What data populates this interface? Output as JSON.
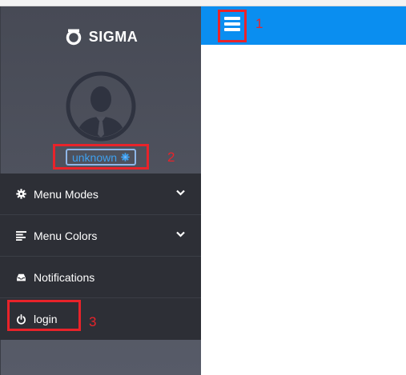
{
  "brand": {
    "name": "SIGMA",
    "logo_icon": "sigma-logo-icon"
  },
  "user": {
    "name": "unknown",
    "settings_icon": "gear-icon"
  },
  "menu": {
    "items": [
      {
        "label": "Menu Modes",
        "icon": "gear-icon",
        "has_submenu": true
      },
      {
        "label": "Menu Colors",
        "icon": "align-left-icon",
        "has_submenu": true
      },
      {
        "label": "Notifications",
        "icon": "inbox-icon",
        "has_submenu": false
      },
      {
        "label": "login",
        "icon": "power-icon",
        "has_submenu": false
      }
    ]
  },
  "annotations": {
    "one": "1",
    "two": "2",
    "three": "3"
  },
  "colors": {
    "sidebar": "#4f525e",
    "menu_bg": "#2d2f36",
    "topbar": "#0a8ef0",
    "accent": "#3ea0ef",
    "annotation_red": "#e8232a"
  }
}
